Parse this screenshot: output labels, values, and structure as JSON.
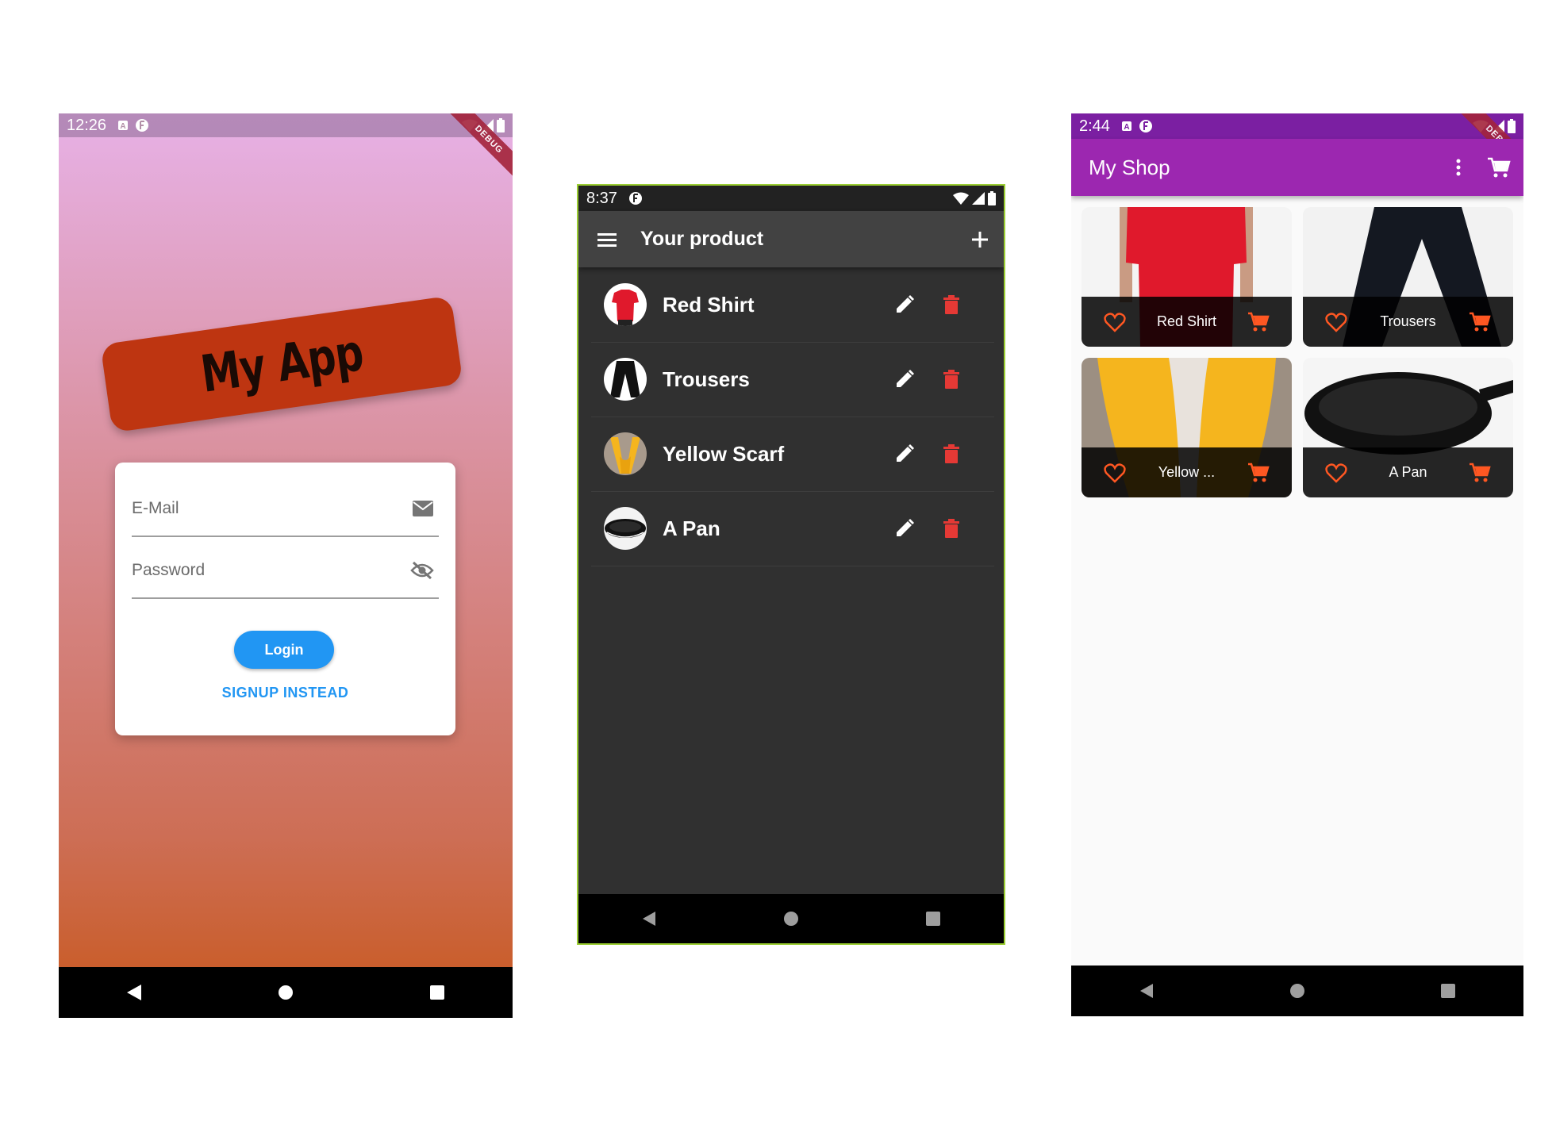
{
  "phone_login": {
    "status_time": "12:26",
    "logo_text": "My App",
    "email_label": "E-Mail",
    "password_label": "Password",
    "login_label": "Login",
    "signup_label": "SIGNUP INSTEAD",
    "debug_banner": "DEBUG"
  },
  "phone_products": {
    "status_time": "8:37",
    "title": "Your product",
    "products": [
      {
        "name": "Red Shirt",
        "thumb": "red-shirt"
      },
      {
        "name": "Trousers",
        "thumb": "trousers"
      },
      {
        "name": "Yellow Scarf",
        "thumb": "yellow-scarf"
      },
      {
        "name": "A Pan",
        "thumb": "pan"
      }
    ],
    "colors": {
      "delete": "#e53935",
      "accent_border": "#9acd32"
    }
  },
  "phone_shop": {
    "status_time": "2:44",
    "title": "My Shop",
    "debug_banner": "DEBUG",
    "items": [
      {
        "name": "Red Shirt"
      },
      {
        "name": "Trousers"
      },
      {
        "name": "Yellow ..."
      },
      {
        "name": "A Pan"
      }
    ],
    "colors": {
      "appbar": "#9c27b0",
      "statusbar": "#7b1fa2",
      "action": "#ff5722"
    }
  }
}
